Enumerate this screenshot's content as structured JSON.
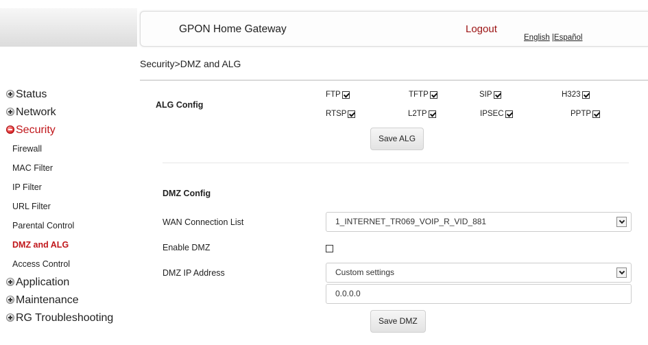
{
  "header": {
    "title": "GPON Home Gateway",
    "logout": "Logout",
    "lang_english": "English",
    "lang_separator": " |",
    "lang_spanish": "Español"
  },
  "breadcrumb": "Security>DMZ and ALG",
  "sidebar": {
    "main": [
      {
        "label": "Status"
      },
      {
        "label": "Network"
      },
      {
        "label": "Security"
      }
    ],
    "sub": [
      {
        "label": "Firewall"
      },
      {
        "label": "MAC Filter"
      },
      {
        "label": "IP Filter"
      },
      {
        "label": "URL Filter"
      },
      {
        "label": "Parental Control"
      },
      {
        "label": "DMZ and ALG"
      },
      {
        "label": "Access Control"
      }
    ],
    "after": [
      {
        "label": "Application"
      },
      {
        "label": "Maintenance"
      },
      {
        "label": "RG Troubleshooting"
      }
    ]
  },
  "alg": {
    "title": "ALG Config",
    "items": [
      {
        "label": "FTP",
        "checked": true
      },
      {
        "label": "TFTP",
        "checked": true
      },
      {
        "label": "SIP",
        "checked": true
      },
      {
        "label": "H323",
        "checked": true
      },
      {
        "label": "RTSP",
        "checked": true
      },
      {
        "label": "L2TP",
        "checked": true
      },
      {
        "label": "IPSEC",
        "checked": true
      },
      {
        "label": "PPTP",
        "checked": true
      }
    ],
    "save_label": "Save ALG"
  },
  "dmz": {
    "title": "DMZ Config",
    "wan_label": "WAN Connection List",
    "wan_value": "1_INTERNET_TR069_VOIP_R_VID_881",
    "enable_label": "Enable DMZ",
    "enable_checked": false,
    "ip_label": "DMZ IP Address",
    "ip_mode_value": "Custom settings",
    "ip_value": "0.0.0.0",
    "save_label": "Save DMZ"
  },
  "colors": {
    "accent_red": "#c0161a",
    "logout_red": "#9b1111"
  }
}
